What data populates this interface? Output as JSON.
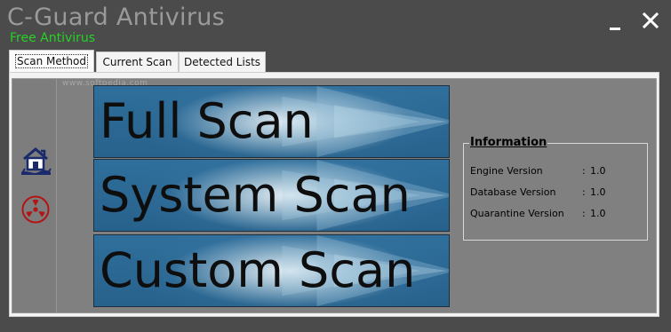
{
  "window": {
    "title": "C-Guard Antivirus",
    "subtitle": "Free Antivirus",
    "minimize_icon": "minimize-icon",
    "close_icon": "close-icon"
  },
  "tabs": [
    {
      "label": "Scan Method",
      "active": true
    },
    {
      "label": "Current Scan",
      "active": false
    },
    {
      "label": "Detected Lists",
      "active": false
    }
  ],
  "sidebar": {
    "items": [
      {
        "icon": "home-icon"
      },
      {
        "icon": "radiation-icon"
      }
    ]
  },
  "watermark": "www.softpedia.com",
  "scan_buttons": [
    {
      "label": "Full Scan"
    },
    {
      "label": "System Scan"
    },
    {
      "label": "Custom Scan"
    }
  ],
  "information": {
    "title": "Information",
    "rows": [
      {
        "label": "Engine Version",
        "sep": ":",
        "value": "1.0"
      },
      {
        "label": "Database Version",
        "sep": ":",
        "value": "1.0"
      },
      {
        "label": "Quarantine Version",
        "sep": ":",
        "value": "1.0"
      }
    ]
  },
  "colors": {
    "title_gray": "#9a9a9a",
    "subtitle_green": "#26d126",
    "window_bg": "#4b4b4b",
    "panel_bg": "#808080",
    "scan_blue": "#2b6893",
    "icon_navy": "#1b2a6b",
    "icon_red": "#b01616"
  }
}
